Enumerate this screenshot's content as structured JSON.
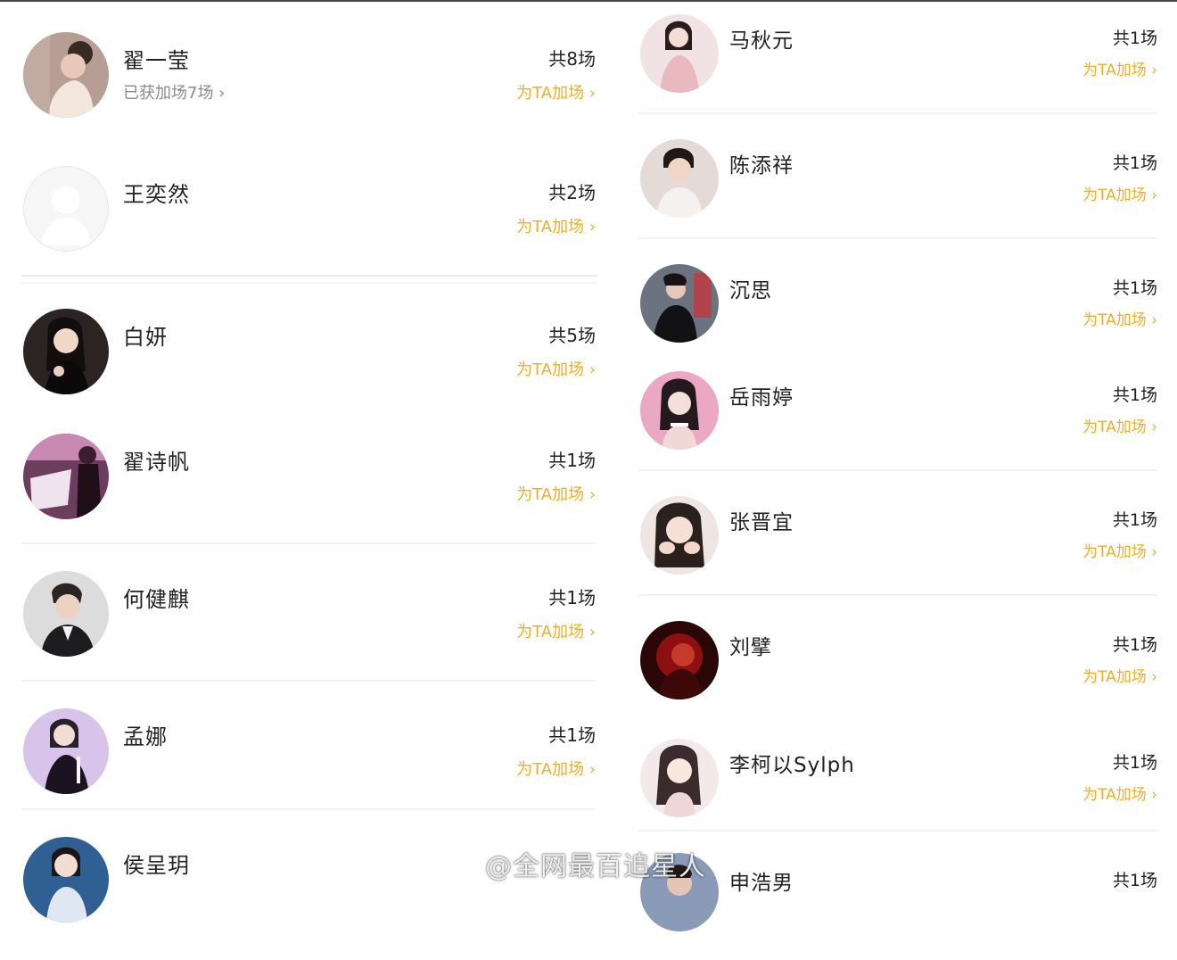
{
  "left_list": [
    {
      "name": "翟一莹",
      "subtitle": "已获加场7场 ›",
      "count": "共8场",
      "action": "为TA加场 ›",
      "avatar": "portrait-woman-updo-avatar"
    },
    {
      "name": "王奕然",
      "count": "共2场",
      "action": "为TA加场 ›",
      "avatar": "default-placeholder-avatar"
    },
    {
      "name": "白妍",
      "count": "共5场",
      "action": "为TA加场 ›",
      "avatar": "portrait-woman-dark-dress-avatar"
    },
    {
      "name": "翟诗帆",
      "count": "共1场",
      "action": "为TA加场 ›",
      "avatar": "stage-photo-avatar"
    },
    {
      "name": "何健麒",
      "count": "共1场",
      "action": "为TA加场 ›",
      "avatar": "portrait-man-suit-avatar"
    },
    {
      "name": "孟娜",
      "count": "共1场",
      "action": "为TA加场 ›",
      "avatar": "portrait-woman-purple-avatar"
    },
    {
      "name": "侯呈玥",
      "count": "",
      "action": "",
      "avatar": "portrait-woman-blue-avatar"
    }
  ],
  "right_list": [
    {
      "name": "马秋元",
      "count": "共1场",
      "action": "为TA加场 ›",
      "avatar": "portrait-woman-pink-dress-avatar"
    },
    {
      "name": "陈添祥",
      "count": "共1场",
      "action": "为TA加场 ›",
      "avatar": "portrait-man-white-shirt-avatar"
    },
    {
      "name": "沉思",
      "count": "共1场",
      "action": "为TA加场 ›",
      "avatar": "portrait-man-black-outfit-avatar"
    },
    {
      "name": "岳雨婷",
      "count": "共1场",
      "action": "为TA加场 ›",
      "avatar": "portrait-woman-pink-bg-avatar"
    },
    {
      "name": "张晋宜",
      "count": "共1场",
      "action": "为TA加场 ›",
      "avatar": "portrait-woman-hands-face-avatar"
    },
    {
      "name": "刘擘",
      "count": "共1场",
      "action": "为TA加场 ›",
      "avatar": "portrait-red-light-avatar"
    },
    {
      "name": "李柯以Sylph",
      "count": "共1场",
      "action": "为TA加场 ›",
      "avatar": "portrait-woman-light-avatar"
    },
    {
      "name": "申浩男",
      "count": "共1场",
      "action": "",
      "avatar": "portrait-partial-avatar"
    }
  ],
  "watermark": {
    "text": "@全网最百追星人",
    "icon": "weibo-icon"
  },
  "colors": {
    "accent": "#f0ad2c",
    "text": "#222222",
    "muted": "#8a8a8a",
    "divider": "#f1f1f1"
  }
}
